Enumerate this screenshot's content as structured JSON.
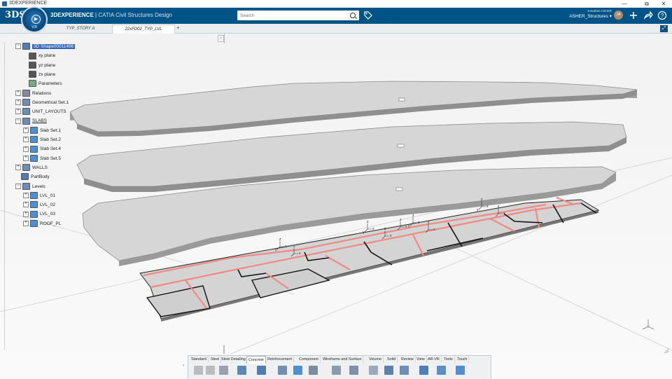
{
  "os_window": {
    "title": "3DEXPERIENCE",
    "controls": {
      "minimize": "—",
      "maximize": "⧉",
      "close": "✕"
    }
  },
  "top_bar": {
    "logo_text": "3DS",
    "brand_bold": "3DEXPERIENCE",
    "brand_sep": " | ",
    "brand_app": "CATIA Civil Structures Design",
    "compass": {
      "label": "V,R",
      "play": "▶"
    },
    "search": {
      "placeholder": "Search",
      "value": ""
    },
    "user": {
      "name": "Jonathan ASHER",
      "collab_space": "ASHER_Structures"
    },
    "avatar_initials": "JA",
    "icons": [
      "tag-icon",
      "add-icon",
      "share-icon",
      "help-icon"
    ]
  },
  "tabs": [
    {
      "label": "TYP_STORY A",
      "active": false
    },
    {
      "label": "22xFD02_TYP_LVL",
      "active": true
    }
  ],
  "tab_add_label": "+",
  "tree": {
    "collapse_label": "‹",
    "nodes": [
      {
        "label": "3D Shape00011496",
        "depth": 1,
        "expander": "−",
        "selected": true,
        "icon": "3d-shape-icon"
      },
      {
        "label": "xy plane",
        "depth": 2,
        "expander": "",
        "icon": "plane-icon"
      },
      {
        "label": "yz plane",
        "depth": 2,
        "expander": "",
        "icon": "plane-icon"
      },
      {
        "label": "zx plane",
        "depth": 2,
        "expander": "",
        "icon": "plane-icon"
      },
      {
        "label": "Parameters",
        "depth": 2,
        "expander": "",
        "icon": "parameters-icon"
      },
      {
        "label": "Relations",
        "depth": 1,
        "expander": "+",
        "icon": "relations-icon"
      },
      {
        "label": "Geometrical Set.1",
        "depth": 1,
        "expander": "+",
        "icon": "geometrical-set-icon"
      },
      {
        "label": "UNIT_LAYOUTS",
        "depth": 1,
        "expander": "+",
        "icon": "geometrical-set-icon"
      },
      {
        "label": "SLABS",
        "depth": 1,
        "expander": "−",
        "underline": true,
        "icon": "geometrical-set-icon"
      },
      {
        "label": "Slab Set.1",
        "depth": 2,
        "expander": "+",
        "icon": "slab-set-icon"
      },
      {
        "label": "Slab Set.2",
        "depth": 2,
        "expander": "+",
        "icon": "slab-set-icon"
      },
      {
        "label": "Slab Set.4",
        "depth": 2,
        "expander": "+",
        "icon": "slab-set-icon"
      },
      {
        "label": "Slab Set.5",
        "depth": 2,
        "expander": "+",
        "icon": "slab-set-icon"
      },
      {
        "label": "WALLS",
        "depth": 1,
        "expander": "+",
        "icon": "geometrical-set-icon"
      },
      {
        "label": "PartBody",
        "depth": 1,
        "expander": "",
        "icon": "partbody-icon"
      },
      {
        "label": "Levels",
        "depth": 1,
        "expander": "−",
        "icon": "geometrical-set-icon"
      },
      {
        "label": "LVL_01",
        "depth": 2,
        "expander": "+",
        "icon": "level-icon"
      },
      {
        "label": "LVL_02",
        "depth": 2,
        "expander": "+",
        "icon": "level-icon"
      },
      {
        "label": "LVL_03",
        "depth": 2,
        "expander": "+",
        "icon": "level-icon"
      },
      {
        "label": "ROOF_PL",
        "depth": 2,
        "expander": "+",
        "icon": "level-icon"
      }
    ]
  },
  "action_bar": {
    "tabs": [
      "Standard",
      "Steel",
      "Steel Detailing",
      "Concrete",
      "Reinforcement",
      "Component",
      "Wireframe and Surface",
      "Volume",
      "Solid",
      "Review",
      "View",
      "AR-VR",
      "Tools",
      "Touch"
    ],
    "active_tab": "Concrete",
    "tools": [
      "cut-icon",
      "copy-icon",
      "paste-icon",
      "undo-icon",
      "update-icon",
      "sketch-icon",
      "slab-icon",
      "grid-icon",
      "column-icon",
      "beam-icon",
      "opening-icon",
      "wall-icon",
      "footing-icon",
      "rebar-icon",
      "stair-icon",
      "ramp-icon"
    ]
  },
  "colors": {
    "top_bar": "#005386",
    "selection": "#3366bb",
    "slab_fill": "#d9d9d9",
    "wall_red": "#f08a84",
    "wall_black": "#111111"
  }
}
